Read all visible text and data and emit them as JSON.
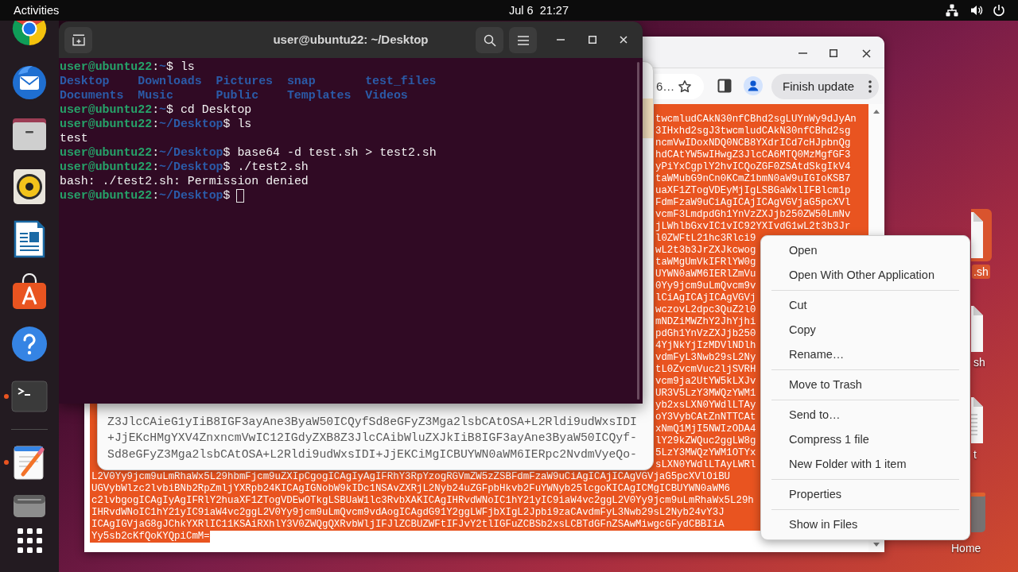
{
  "top_bar": {
    "activities": "Activities",
    "clock": "Jul 6  21:27"
  },
  "dock": {
    "favorites": [
      {
        "kind": "round-logo",
        "running": false
      },
      {
        "kind": "mail",
        "running": false
      },
      {
        "kind": "folder",
        "running": false
      },
      {
        "kind": "speaker",
        "running": false
      },
      {
        "kind": "document",
        "running": false
      },
      {
        "kind": "store",
        "running": false
      },
      {
        "kind": "help",
        "running": false
      },
      {
        "kind": "terminal",
        "running": true
      }
    ],
    "others": [
      {
        "kind": "text-editor",
        "running": true
      },
      {
        "kind": "drive",
        "running": false
      }
    ]
  },
  "terminal": {
    "title": "user@ubuntu22: ~/Desktop",
    "lines": [
      {
        "kind": "prompt",
        "user": "user@ubuntu22",
        "colon": ":",
        "path": "~",
        "command": "$ ls",
        "cursor": false
      },
      {
        "kind": "listing",
        "entries": [
          "Desktop",
          "Downloads",
          "Pictures",
          "snap",
          "test_files"
        ]
      },
      {
        "kind": "listing",
        "entries": [
          "Documents",
          "Music",
          "Public",
          "Templates",
          "Videos"
        ]
      },
      {
        "kind": "prompt",
        "user": "user@ubuntu22",
        "colon": ":",
        "path": "~",
        "command": "$ cd Desktop",
        "cursor": false
      },
      {
        "kind": "prompt",
        "user": "user@ubuntu22",
        "colon": ":",
        "path": "~/Desktop",
        "command": "$ ls",
        "cursor": false
      },
      {
        "kind": "output",
        "text": "test"
      },
      {
        "kind": "prompt",
        "user": "user@ubuntu22",
        "colon": ":",
        "path": "~/Desktop",
        "command": "$ base64 -d test.sh > test2.sh",
        "cursor": false
      },
      {
        "kind": "prompt",
        "user": "user@ubuntu22",
        "colon": ":",
        "path": "~/Desktop",
        "command": "$ ./test2.sh",
        "cursor": false
      },
      {
        "kind": "output",
        "text": "bash: ./test2.sh: Permission denied"
      },
      {
        "kind": "prompt",
        "user": "user@ubuntu22",
        "colon": ":",
        "path": "~/Desktop",
        "command": "$",
        "cursor": true
      }
    ]
  },
  "text_editor": {
    "lines": [
      "Z3JlcCAieG1yIiB8IGF3ayAne3ByaW50ICQyfSd8eGFyZ3Mga2lsbCAtOSA+L2Rldi9udWxsIDI",
      "+JjEKcHMgYXV4ZnxncmVwIC12IGdyZXB8Z3JlcCAibWluZXJkIiB8IGF3ayAne3ByaW50ICQyf-",
      "Sd8eGFyZ3Mga2lsbCAtOSA+L2Rldi9udWxsIDI+JjEKCiMgICBUYWN0aWM6IERpc2NvdmVyeQo-"
    ]
  },
  "browser": {
    "address": "6…",
    "update_button": "Finish update",
    "page_text": {
      "selected": true,
      "right_column": [
        "twcmludCAkN30nfCBhd2sgLUYnWy9dJyAn",
        "3IHxhd2sgJ3twcmludCAkN30nfCBhd2sg",
        "ncmVwIDoxNDQ0NCB8YXdrICd7cHJpbnQg",
        "hdCAtYW5wIHwgZ3JlcCA6MTQ0MzMgfGF3",
        "yPiYxCgplY2hvICQoZGF0ZSAtdSkgIkV4",
        "taWMubG9nCn0KCmZ1bmN0aW9uIGIoKSB7",
        "uaXF1ZTogVDEyMjIgLSBGaWxlIFBlcm1p",
        "FdmFzaW9uCiAgICAjICAgVGVjaG5pcXVl",
        "vcmF3LmdpdGh1YnVzZXJjb250ZW50LmNv",
        "jLWhlbGxvIC1vIC92YXIvdG1wL2t3b3Jr",
        "l0ZWFtL21hc3Rlci9",
        "wL2t3b3JrZXJkcwog",
        "taWMgUmVkIFRlYW0g",
        "UYWN0aWM6IERlZmVu",
        "0Yy9jcm9uLmQvcm9v",
        "lCiAgICAjICAgVGVj",
        "wczovL2dpc3QuZ2l0",
        "mNDZiMWZhY2JhYjhi",
        "pdGh1YnVzZXJjb250",
        "4YjNkYjIzMDVlNDlh",
        "vdmFyL3Nwb29sL2Ny",
        "tL0ZvcmVuc2ljSVRH",
        "vcm9ja2UtYW5kLXJv",
        "UR3V5LzY3MWQzYWM1",
        "yb2xsLXN0YWdlLTAy",
        "oY3VybCAtZnNTTCAt",
        "xNmQ1MjI5NWIzODA4",
        "lY29kZWQuc2ggLW8g",
        "5LzY3MWQzYWM1OTYx",
        "sLXN0YWdlLTAyLWRl"
      ],
      "lines": [
        "L2V0Yy9jcm9uLmRhaWx5L29hbmFjcm9uZXIpCgogICAgIyAgIFRhY3RpYzogRGVmZW5zZSBFdmFzaW9uCiAgICAjICAgVGVjaG5pcXVlOiBU",
        "UGVybWlzc2lvbiBNb2RpZmljYXRpb24KICAgIGNobW9kIDc1NSAvZXRjL2Nyb24uZGFpbHkvb2FuYWNyb25lcgoKICAgICMgICBUYWN0aWM6",
        "c2lvbgogICAgIyAgIFRlY2huaXF1ZTogVDEwOTkgLSBUaW1lc3RvbXAKICAgIHRvdWNoIC1hY21yIC9iaW4vc2ggL2V0Yy9jcm9uLmRhaWx5L29h",
        "IHRvdWNoIC1hY21yIC9iaW4vc2ggL2V0Yy9jcm9uLmQvcm9vdAogICAgdG91Y2ggLWFjbXIgL2Jpbi9zaCAvdmFyL3Nwb29sL2Nyb24vY3J",
        "ICAgIGVjaG8gJChkYXRlIC11KSAiRXhlY3V0ZWQgQXRvbWljIFJlZCBUZWFtIFJvY2tlIGFuZCBSb2xsLCBTdGFnZSAwMiwgcGFydCBBIiA"
      ],
      "last_line": "Yy5sb2cKfQoKYQpiCmM="
    }
  },
  "desktop_icons": [
    {
      "kind": "script",
      "label": ".sh",
      "selected": true
    },
    {
      "kind": "file",
      "label": "sh",
      "selected": false
    },
    {
      "kind": "text",
      "label": "t",
      "selected": false
    },
    {
      "kind": "home",
      "label": "Home",
      "selected": false
    }
  ],
  "context_menu": {
    "sections": [
      [
        "Open",
        "Open With Other Application"
      ],
      [
        "Cut",
        "Copy",
        "Rename…"
      ],
      [
        "Move to Trash"
      ],
      [
        "Send to…",
        "Compress 1 file",
        "New Folder with 1 item"
      ],
      [
        "Properties"
      ],
      [
        "Show in Files"
      ]
    ]
  }
}
